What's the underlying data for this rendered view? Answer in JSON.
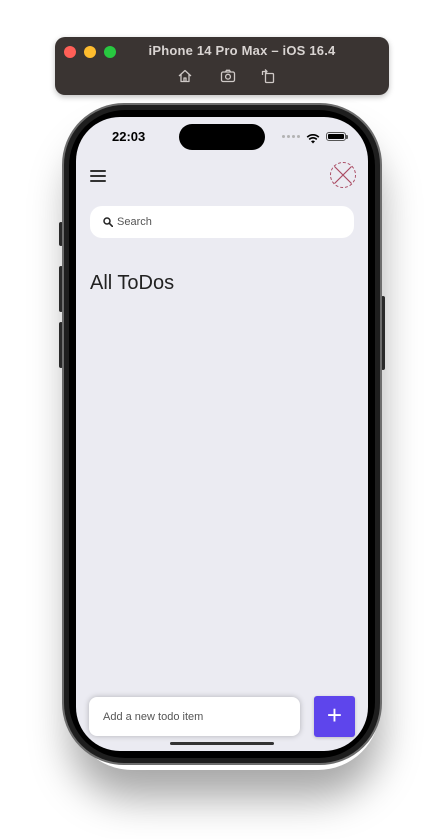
{
  "simulator": {
    "title": "iPhone 14 Pro Max – iOS 16.4",
    "toolbar_icons": [
      "home-icon",
      "screenshot-icon",
      "rotate-icon"
    ]
  },
  "status_bar": {
    "time": "22:03",
    "icons": [
      "cellular-signal-icon",
      "wifi-icon",
      "battery-icon"
    ]
  },
  "app": {
    "menu_icon": "hamburger-menu-icon",
    "avatar_icon": "broken-image-avatar-icon",
    "search": {
      "placeholder": "Search",
      "value": ""
    },
    "title": "All ToDos",
    "todo_input": {
      "placeholder": "Add a new todo item",
      "value": ""
    },
    "add_button_label": "+"
  },
  "colors": {
    "screen_background": "#ebebf2",
    "accent": "#5e45ec",
    "avatar_border": "#a94a62"
  }
}
